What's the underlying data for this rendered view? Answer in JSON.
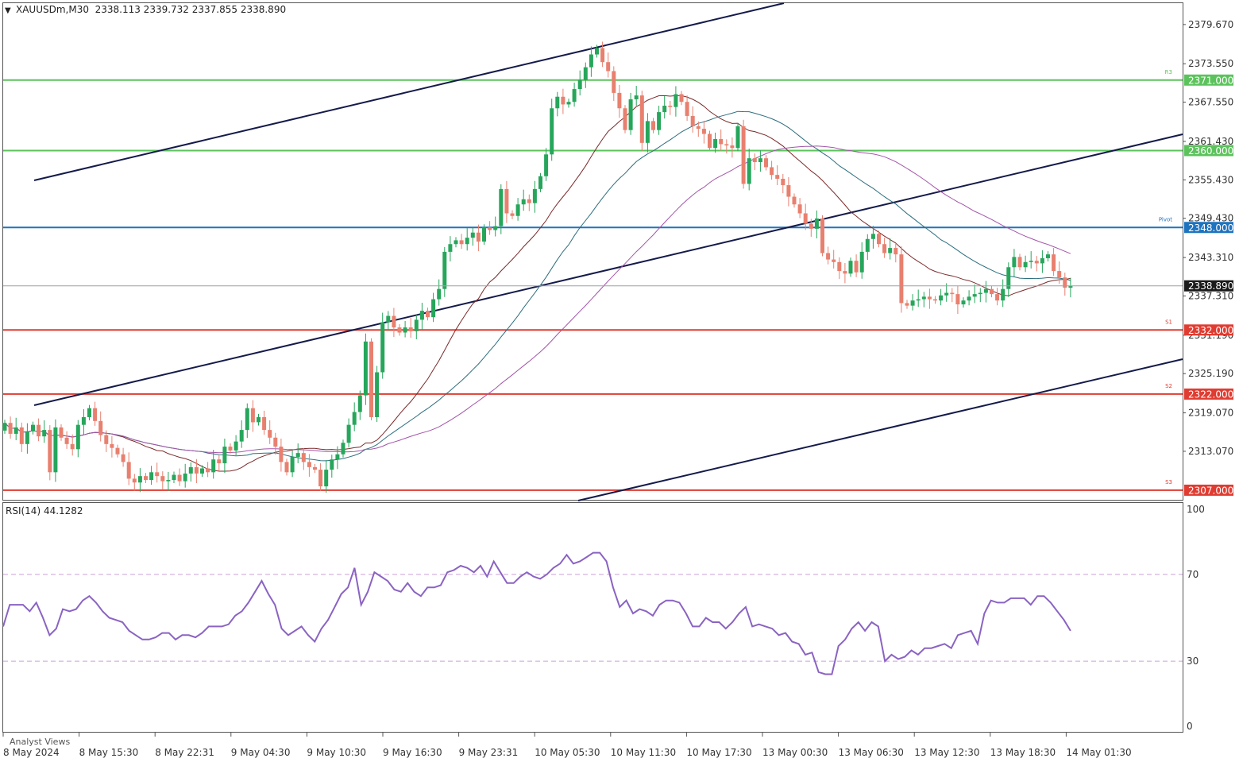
{
  "header": {
    "symbol_line": "XAUUSDm,M30  2338.113 2339.732 2337.855 2338.890"
  },
  "rsi_header": {
    "label": "RSI(14) 44.1282"
  },
  "watermark": "Analyst Views",
  "price_axis": {
    "ticks": [
      "2379.670",
      "2373.550",
      "2367.550",
      "2361.430",
      "2355.430",
      "2349.430",
      "2343.310",
      "2337.310",
      "2331.190",
      "2325.190",
      "2319.070",
      "2313.070"
    ]
  },
  "level_labels": [
    {
      "label": "2371.000",
      "price": 2371.0,
      "color": "#5cc35c",
      "tag": "R3"
    },
    {
      "label": "2360.000",
      "price": 2360.0,
      "color": "#5cc35c",
      "tag": ""
    },
    {
      "label": "2348.000",
      "price": 2348.0,
      "color": "#1e73be",
      "tag": "Pivot"
    },
    {
      "label": "2332.000",
      "price": 2332.0,
      "color": "#e03c31",
      "tag": "S1"
    },
    {
      "label": "2322.000",
      "price": 2322.0,
      "color": "#e03c31",
      "tag": "S2"
    },
    {
      "label": "2307.000",
      "price": 2307.0,
      "color": "#e03c31",
      "tag": "S3"
    }
  ],
  "current_price": {
    "label": "2338.890",
    "price": 2338.89
  },
  "rsi_axis": {
    "ticks": [
      "100",
      "70",
      "30",
      "0"
    ]
  },
  "time_axis": {
    "labels": [
      "8 May 2024",
      "8 May 15:30",
      "8 May 22:31",
      "9 May 04:30",
      "9 May 10:30",
      "9 May 16:30",
      "9 May 23:31",
      "10 May 05:30",
      "10 May 11:30",
      "10 May 17:30",
      "13 May 00:30",
      "13 May 06:30",
      "13 May 12:30",
      "13 May 18:30",
      "14 May 01:30"
    ]
  },
  "colors": {
    "bull": "#26a65b",
    "bear": "#e8806f",
    "ma_fast": "#7a2a2a",
    "ma_mid": "#2d6e7e",
    "ma_slow": "#a355a8",
    "rsi_line": "#8a63c2",
    "channel": "#141a4a"
  },
  "chart_data": [
    {
      "type": "candlestick",
      "title": "XAUUSDm,M30",
      "ylim": [
        2305.5,
        2383.0
      ],
      "candles_close": [
        2317.5,
        2315.8,
        2316.8,
        2314.2,
        2316.2,
        2317.2,
        2315.4,
        2316.4,
        2309.8,
        2316.8,
        2315.2,
        2314.2,
        2313.4,
        2317.2,
        2318.4,
        2319.8,
        2317.8,
        2315.6,
        2314.2,
        2313.6,
        2312.6,
        2311.4,
        2308.8,
        2308.2,
        2309.2,
        2308.6,
        2309.8,
        2309.2,
        2308.4,
        2308.6,
        2309.4,
        2308.4,
        2309.6,
        2310.6,
        2309.6,
        2310.4,
        2309.8,
        2311.8,
        2311.2,
        2313.8,
        2313.2,
        2314.6,
        2316.4,
        2319.8,
        2317.6,
        2318.4,
        2316.4,
        2315.2,
        2313.8,
        2311.4,
        2309.8,
        2312.2,
        2312.8,
        2311.4,
        2310.6,
        2310.2,
        2307.6,
        2310.2,
        2311.8,
        2312.6,
        2314.4,
        2317.2,
        2319.2,
        2321.8,
        2330.2,
        2318.4,
        2325.4,
        2333.2,
        2334.2,
        2332.4,
        2331.6,
        2332.4,
        2331.8,
        2333.6,
        2335.0,
        2334.0,
        2336.8,
        2338.4,
        2344.2,
        2345.4,
        2346.0,
        2345.4,
        2346.4,
        2347.2,
        2345.8,
        2348.0,
        2347.6,
        2348.2,
        2354.0,
        2350.2,
        2349.8,
        2351.6,
        2352.4,
        2351.8,
        2354.0,
        2356.0,
        2359.4,
        2366.6,
        2368.4,
        2367.2,
        2367.6,
        2369.6,
        2371.0,
        2373.0,
        2375.0,
        2376.0,
        2373.8,
        2372.4,
        2369.0,
        2366.6,
        2363.2,
        2368.0,
        2368.6,
        2361.2,
        2364.6,
        2363.2,
        2366.0,
        2367.0,
        2366.8,
        2368.8,
        2367.6,
        2365.4,
        2363.8,
        2363.4,
        2362.6,
        2360.4,
        2361.8,
        2361.0,
        2360.8,
        2360.4,
        2363.8,
        2354.8,
        2358.8,
        2358.2,
        2358.8,
        2357.4,
        2356.2,
        2355.6,
        2354.6,
        2352.8,
        2351.6,
        2350.2,
        2348.6,
        2347.8,
        2349.4,
        2344.0,
        2343.0,
        2342.6,
        2341.2,
        2340.8,
        2342.8,
        2341.0,
        2344.2,
        2346.2,
        2347.0,
        2345.4,
        2344.0,
        2344.8,
        2343.8,
        2336.2,
        2335.8,
        2336.6,
        2336.8,
        2337.2,
        2336.8,
        2336.6,
        2337.4,
        2337.8,
        2337.6,
        2336.0,
        2336.6,
        2337.2,
        2337.6,
        2337.8,
        2338.4,
        2337.6,
        2336.6,
        2338.4,
        2341.8,
        2343.4,
        2341.8,
        2342.6,
        2342.8,
        2342.4,
        2343.2,
        2343.8,
        2341.2,
        2340.2,
        2338.6,
        2338.9
      ],
      "moving_averages": [
        "fast",
        "mid",
        "slow"
      ]
    },
    {
      "type": "line",
      "title": "RSI(14) 44.1282",
      "ylim": [
        0,
        100
      ],
      "reference_levels": [
        70,
        30
      ],
      "values": [
        46,
        56,
        56,
        56,
        53,
        57,
        50,
        42,
        45,
        54,
        53,
        54,
        58,
        60,
        57,
        53,
        50,
        49,
        48,
        44,
        42,
        40,
        40,
        41,
        43,
        43,
        40,
        42,
        42,
        41,
        43,
        46,
        46,
        46,
        47,
        51,
        53,
        57,
        62,
        67,
        61,
        56,
        45,
        42,
        44,
        46,
        42,
        39,
        45,
        49,
        55,
        61,
        64,
        73,
        56,
        62,
        71,
        69,
        67,
        63,
        62,
        66,
        62,
        60,
        64,
        64,
        65,
        71,
        72,
        74,
        73,
        71,
        74,
        69,
        76,
        71,
        66,
        66,
        69,
        71,
        69,
        68,
        70,
        73,
        75,
        79,
        75,
        76,
        78,
        80,
        80,
        76,
        64,
        55,
        58,
        52,
        54,
        53,
        51,
        56,
        58,
        58,
        57,
        52,
        46,
        46,
        50,
        48,
        48,
        45,
        48,
        52,
        55,
        46,
        47,
        46,
        45,
        42,
        43,
        39,
        38,
        33,
        34,
        25,
        24,
        24,
        37,
        40,
        45,
        48,
        44,
        48,
        46,
        30,
        33,
        31,
        32,
        35,
        33,
        36,
        36,
        37,
        38,
        36,
        42,
        43,
        44,
        38,
        52,
        58,
        57,
        57,
        59,
        59,
        59,
        56,
        60,
        60,
        57,
        53,
        49,
        44
      ]
    }
  ]
}
